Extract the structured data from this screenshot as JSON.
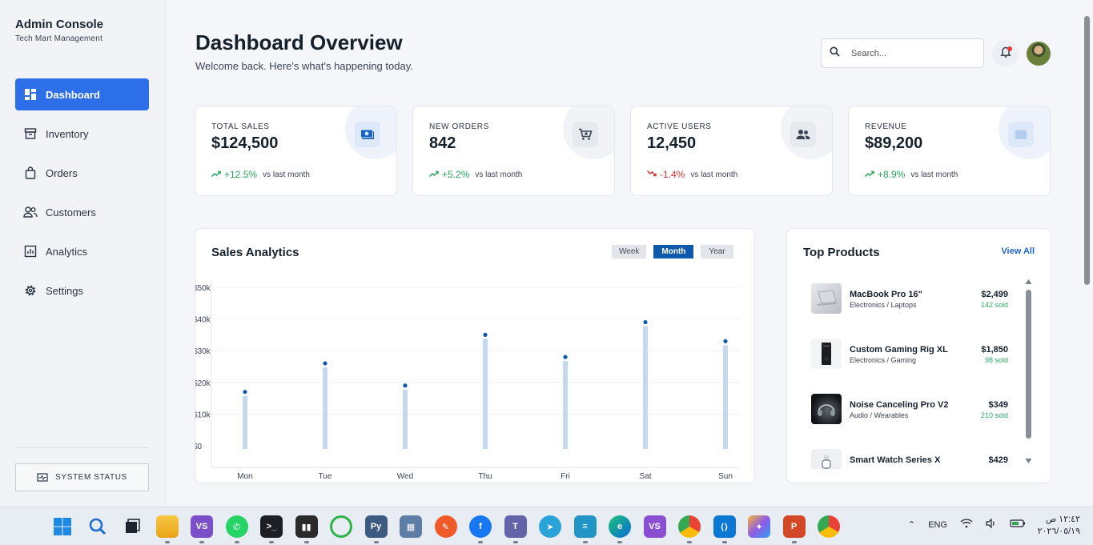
{
  "sidebar": {
    "title": "Admin Console",
    "subtitle": "Tech Mart Management",
    "items": [
      {
        "label": "Dashboard",
        "icon": "dashboard-icon"
      },
      {
        "label": "Inventory",
        "icon": "inventory-icon"
      },
      {
        "label": "Orders",
        "icon": "orders-bag-icon"
      },
      {
        "label": "Customers",
        "icon": "customers-icon"
      },
      {
        "label": "Analytics",
        "icon": "analytics-icon"
      },
      {
        "label": "Settings",
        "icon": "settings-gear-icon"
      }
    ],
    "system_status": "SYSTEM STATUS"
  },
  "header": {
    "title": "Dashboard Overview",
    "subtitle": "Welcome back. Here's what's happening today.",
    "search_placeholder": "Search..."
  },
  "stats": [
    {
      "label": "TOTAL SALES",
      "value": "$124,500",
      "change": "+12.5%",
      "direction": "up",
      "note": "vs last month",
      "icon": "money-icon"
    },
    {
      "label": "NEW ORDERS",
      "value": "842",
      "change": "+5.2%",
      "direction": "up",
      "note": "vs last month",
      "icon": "cart-icon"
    },
    {
      "label": "ACTIVE USERS",
      "value": "12,450",
      "change": "-1.4%",
      "direction": "down",
      "note": "vs last month",
      "icon": "users-icon"
    },
    {
      "label": "REVENUE",
      "value": "$89,200",
      "change": "+8.9%",
      "direction": "up",
      "note": "vs last month",
      "icon": "wallet-icon"
    }
  ],
  "sales": {
    "title": "Sales Analytics",
    "ranges": [
      "Week",
      "Month",
      "Year"
    ],
    "active_range": "Month"
  },
  "chart_data": {
    "type": "bar",
    "categories": [
      "Mon",
      "Tue",
      "Wed",
      "Thu",
      "Fri",
      "Sat",
      "Sun"
    ],
    "values": [
      17000,
      26000,
      19000,
      35000,
      28000,
      39000,
      33000
    ],
    "ylim": [
      0,
      50000
    ],
    "yticks": [
      "$0",
      "$10k",
      "$20k",
      "$30k",
      "$40k",
      "$50k"
    ],
    "grid": true,
    "colors": {
      "bar": "#c5d9ee",
      "point": "#0f59ad"
    }
  },
  "products": {
    "title": "Top Products",
    "view_all": "View All",
    "items": [
      {
        "name": "MacBook Pro 16\"",
        "category": "Electronics / Laptops",
        "price": "$2,499",
        "sold": "142 sold"
      },
      {
        "name": "Custom Gaming Rig XL",
        "category": "Electronics / Gaming",
        "price": "$1,850",
        "sold": "98 sold"
      },
      {
        "name": "Noise Canceling Pro V2",
        "category": "Audio / Wearables",
        "price": "$349",
        "sold": "210 sold"
      },
      {
        "name": "Smart Watch Series X",
        "category": "",
        "price": "$429",
        "sold": ""
      }
    ]
  },
  "taskbar": {
    "lang": "ENG",
    "time": "١٢:٤٢ ص",
    "date": "٢٠٢٦/٠٥/١٩"
  }
}
